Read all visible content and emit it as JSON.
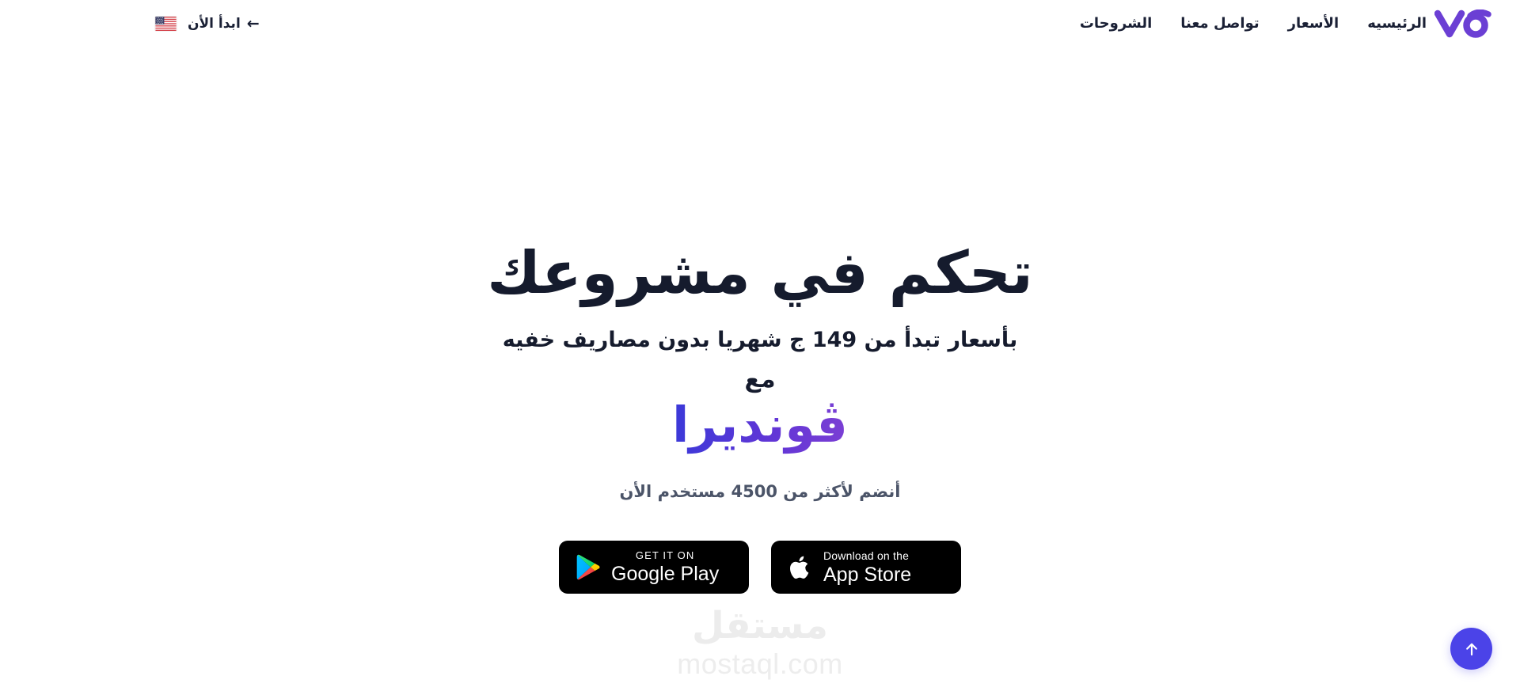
{
  "nav": {
    "logo_alt": "vo-logo",
    "logo_color": "#6b3fd4",
    "links": [
      {
        "label": "الرئيسيه",
        "name": "nav-link-home"
      },
      {
        "label": "الأسعار",
        "name": "nav-link-pricing"
      },
      {
        "label": "تواصل معنا",
        "name": "nav-link-contact"
      },
      {
        "label": "الشروحات",
        "name": "nav-link-tutorials"
      }
    ],
    "cta": {
      "label": "ابدأ الأن",
      "arrow": "←"
    },
    "language_flag": "us-flag-icon"
  },
  "hero": {
    "headline": "تحكم في مشروعك",
    "subheadline": "بأسعار تبدأ من 149 ج شهريا بدون مصاريف خفيه",
    "with_word": "مع",
    "brand_name": "ڤونديرا",
    "brand_gradient_from": "#7b3fd4",
    "brand_gradient_to": "#3b39d8",
    "users_note": "أنضم لأكثر من 4500 مستخدم الأن",
    "headline_color": "#151b2d"
  },
  "stores": {
    "google_play": {
      "top": "GET IT ON",
      "main": "Google Play",
      "icon": "google-play-icon"
    },
    "app_store": {
      "top": "Download on the",
      "main": "App Store",
      "icon": "apple-icon"
    }
  },
  "watermark": {
    "arabic": "مستقل",
    "latin": "mostaql.com"
  },
  "scroll_top": {
    "icon": "arrow-up-icon",
    "color": "#4b43e8"
  }
}
